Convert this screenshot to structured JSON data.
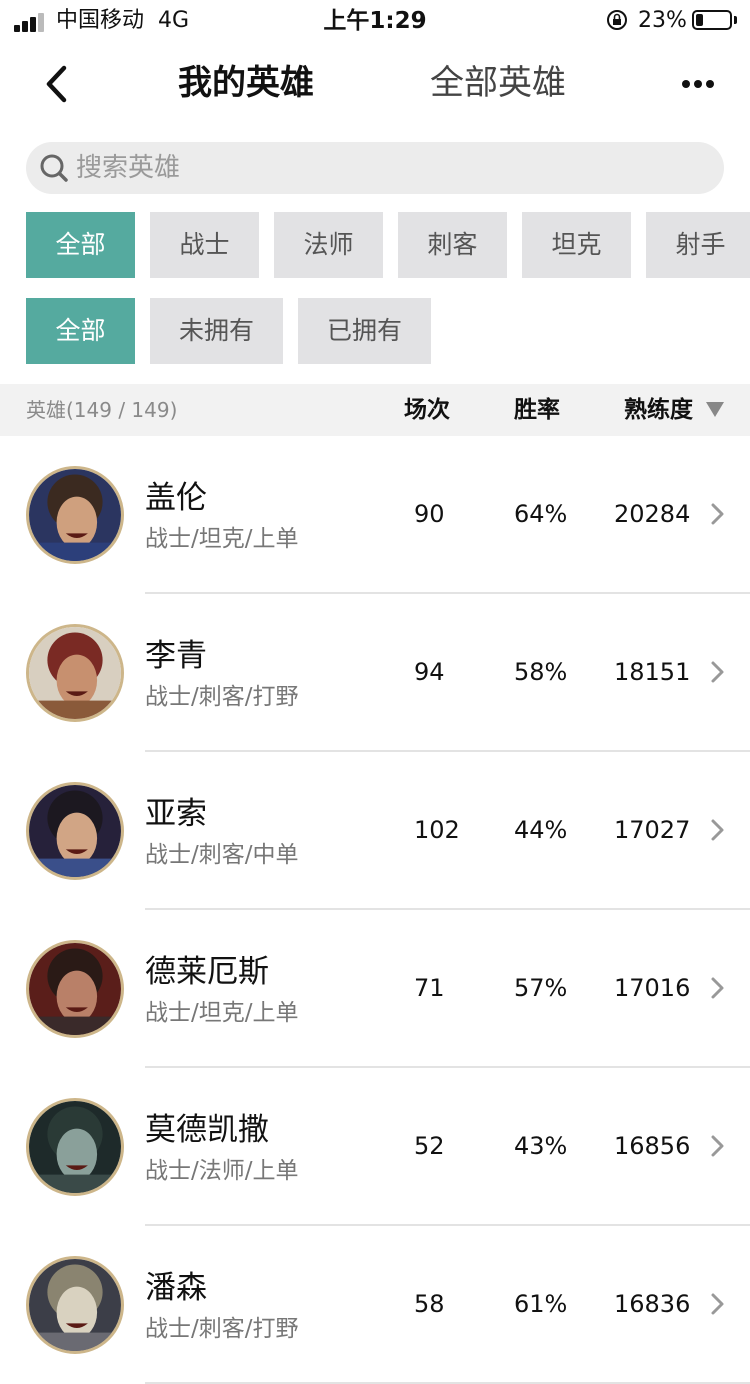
{
  "status_bar": {
    "carrier": "中国移动",
    "network": "4G",
    "time": "上午1:29",
    "battery": "23%",
    "battery_level": 0.23
  },
  "nav": {
    "tab_mine": "我的英雄",
    "tab_all": "全部英雄"
  },
  "search": {
    "placeholder": "搜索英雄"
  },
  "role_filters": [
    "全部",
    "战士",
    "法师",
    "刺客",
    "坦克",
    "射手"
  ],
  "role_filter_selected": "全部",
  "ownership_filters": [
    "全部",
    "未拥有",
    "已拥有"
  ],
  "ownership_filter_selected": "全部",
  "list_header": {
    "count_label": "英雄(149 / 149)",
    "games": "场次",
    "winrate": "胜率",
    "proficiency": "熟练度"
  },
  "heroes": [
    {
      "name": "盖伦",
      "roles": "战士/坦克/上单",
      "games": "90",
      "winrate": "64%",
      "proficiency": "20284"
    },
    {
      "name": "李青",
      "roles": "战士/刺客/打野",
      "games": "94",
      "winrate": "58%",
      "proficiency": "18151"
    },
    {
      "name": "亚索",
      "roles": "战士/刺客/中单",
      "games": "102",
      "winrate": "44%",
      "proficiency": "17027"
    },
    {
      "name": "德莱厄斯",
      "roles": "战士/坦克/上单",
      "games": "71",
      "winrate": "57%",
      "proficiency": "17016"
    },
    {
      "name": "莫德凯撒",
      "roles": "战士/法师/上单",
      "games": "52",
      "winrate": "43%",
      "proficiency": "16856"
    },
    {
      "name": "潘森",
      "roles": "战士/刺客/打野",
      "games": "58",
      "winrate": "61%",
      "proficiency": "16836"
    }
  ],
  "colors": {
    "accent": "#55aa9f",
    "chip_bg": "#e2e2e4",
    "avatar_ring": "#cdb68a"
  }
}
